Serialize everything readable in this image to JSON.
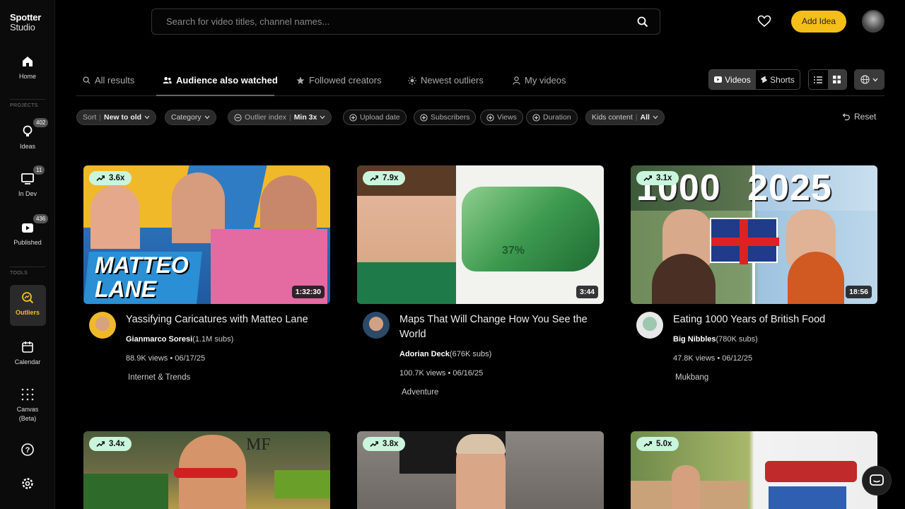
{
  "app": {
    "name_line1": "Spotter",
    "name_line2": "Studio"
  },
  "sidebar": {
    "home": "Home",
    "projects_label": "PROJECTS",
    "ideas": {
      "label": "Ideas",
      "count": "402"
    },
    "in_dev": {
      "label": "In Dev",
      "count": "11"
    },
    "published": {
      "label": "Published",
      "count": "436"
    },
    "tools_label": "TOOLS",
    "outliers": "Outliers",
    "calendar": "Calendar",
    "canvas_line1": "Canvas",
    "canvas_line2": "(Beta)"
  },
  "header": {
    "search_placeholder": "Search for video titles, channel names...",
    "add_idea": "Add Idea"
  },
  "tabs": [
    "All results",
    "Audience also watched",
    "Followed creators",
    "Newest outliers",
    "My videos"
  ],
  "view": {
    "videos": "Videos",
    "shorts": "Shorts"
  },
  "filters": {
    "sort_label": "Sort",
    "sort_value": "New to old",
    "category": "Category",
    "outlier_label": "Outlier index",
    "outlier_value": "Min 3x",
    "upload_date": "Upload date",
    "subscribers": "Subscribers",
    "views": "Views",
    "duration": "Duration",
    "kids_label": "Kids content",
    "kids_value": "All",
    "reset": "Reset"
  },
  "videos": [
    {
      "multiplier": "3.6x",
      "duration": "1:32:30",
      "title": "Yassifying Caricatures with Matteo Lane",
      "channel": "Gianmarco Soresi",
      "subs": "(1.1M subs)",
      "stats": "88.9K views • 06/17/25",
      "category": "Internet & Trends",
      "thumb_text": "MATTEO LANE"
    },
    {
      "multiplier": "7.9x",
      "duration": "3:44",
      "title": "Maps That Will Change How You See the World",
      "channel": "Adorian Deck",
      "subs": "(676K subs)",
      "stats": "100.7K views • 06/16/25",
      "category": "Adventure",
      "thumb_text": "37%"
    },
    {
      "multiplier": "3.1x",
      "duration": "18:56",
      "title": "Eating 1000 Years of British Food",
      "channel": "Big Nibbles",
      "subs": "(780K subs)",
      "stats": "47.8K views • 06/12/25",
      "category": "Mukbang",
      "thumb_text": "1000 2025"
    },
    {
      "multiplier": "3.4x",
      "thumb_text": "MF"
    },
    {
      "multiplier": "3.8x"
    },
    {
      "multiplier": "5.0x"
    }
  ]
}
